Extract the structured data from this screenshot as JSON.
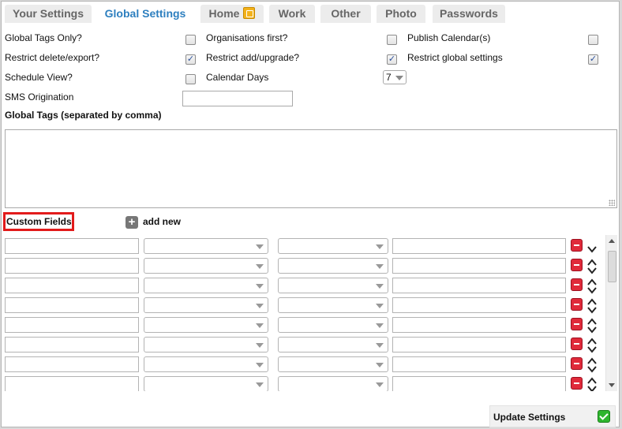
{
  "tabs": [
    {
      "label": "Your Settings",
      "active": false
    },
    {
      "label": "Global Settings",
      "active": true
    },
    {
      "label": "Home",
      "active": false,
      "icon": "edit-icon"
    },
    {
      "label": "Work",
      "active": false
    },
    {
      "label": "Other",
      "active": false
    },
    {
      "label": "Photo",
      "active": false
    },
    {
      "label": "Passwords",
      "active": false
    }
  ],
  "settings": {
    "global_tags_only": {
      "label": "Global Tags Only?",
      "checked": false
    },
    "organisations_first": {
      "label": "Organisations first?",
      "checked": false
    },
    "publish_calendars": {
      "label": "Publish Calendar(s)",
      "checked": false
    },
    "restrict_delete_export": {
      "label": "Restrict delete/export?",
      "checked": true
    },
    "restrict_add_upgrade": {
      "label": "Restrict add/upgrade?",
      "checked": true
    },
    "restrict_global_settings": {
      "label": "Restrict global settings",
      "checked": true
    },
    "schedule_view": {
      "label": "Schedule View?",
      "checked": false
    },
    "calendar_days": {
      "label": "Calendar Days",
      "value": "7"
    },
    "sms_origination": {
      "label": "SMS Origination",
      "value": ""
    }
  },
  "global_tags": {
    "label": "Global Tags (separated by comma)",
    "value": ""
  },
  "custom_fields": {
    "label": "Custom Fields",
    "add_label": "add new",
    "rows": [
      {
        "name": "",
        "type": "",
        "option": "",
        "value": "",
        "first": true
      },
      {
        "name": "",
        "type": "",
        "option": "",
        "value": ""
      },
      {
        "name": "",
        "type": "",
        "option": "",
        "value": ""
      },
      {
        "name": "",
        "type": "",
        "option": "",
        "value": ""
      },
      {
        "name": "",
        "type": "",
        "option": "",
        "value": ""
      },
      {
        "name": "",
        "type": "",
        "option": "",
        "value": ""
      },
      {
        "name": "",
        "type": "",
        "option": "",
        "value": ""
      },
      {
        "name": "",
        "type": "",
        "option": "",
        "value": ""
      }
    ]
  },
  "footer": {
    "update_label": "Update Settings"
  },
  "colors": {
    "active_tab": "#2d7fbf",
    "highlight": "#e21b1b",
    "remove": "#e02a3a",
    "confirm": "#2fb52f"
  }
}
